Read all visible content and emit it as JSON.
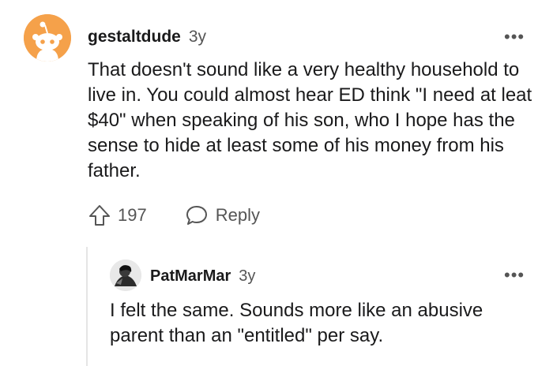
{
  "comment": {
    "author": "gestaltdude",
    "age": "3y",
    "body": "That doesn't sound like a very healthy household to live in. You could almost hear ED think \"I need at leat $40\" when speaking of his son, who I hope has the sense to hide at least some of his money from his father.",
    "votes": "197",
    "reply_label": "Reply",
    "more_label": "•••",
    "avatar_icon": "reddit-alien-avatar",
    "upvote_icon": "upvote-arrow-icon",
    "reply_icon": "speech-bubble-icon"
  },
  "reply": {
    "author": "PatMarMar",
    "age": "3y",
    "body": "I felt the same. Sounds more like an abusive parent than an \"entitled\" per say.",
    "more_label": "•••",
    "avatar_icon": "user-photo-avatar"
  },
  "colors": {
    "avatar_bg": "#f5a14a",
    "text": "#1a1a1b",
    "muted": "#555555",
    "thread_line": "#e5e5e5"
  }
}
